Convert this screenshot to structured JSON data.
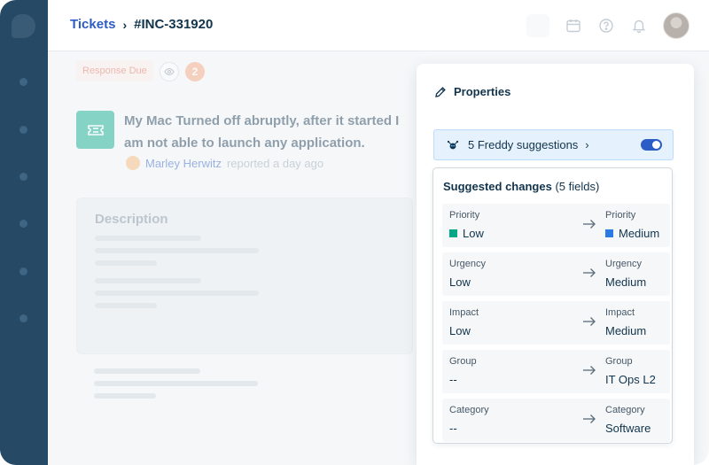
{
  "header": {
    "breadcrumb_root": "Tickets",
    "breadcrumb_sep": "›",
    "ticket_id": "#INC-331920",
    "icons": [
      "calendar-icon",
      "help-icon",
      "bell-icon",
      "avatar"
    ]
  },
  "ticket": {
    "status_tag": "Response Due",
    "watchers_count": "2",
    "subject": "My Mac Turned off abruptly, after it started I am not able to launch any application.",
    "reporter_name": "Marley Herwitz",
    "reported_text": "reported a day ago",
    "description_title": "Description"
  },
  "properties": {
    "title": "Properties",
    "freddy_label": "5 Freddy suggestions",
    "freddy_enabled": true,
    "suggested_title": "Suggested changes",
    "suggested_count": "(5 fields)",
    "changes": [
      {
        "field": "Priority",
        "from": "Low",
        "to": "Medium",
        "from_color": "#00a886",
        "to_color": "#2c7be5"
      },
      {
        "field": "Urgency",
        "from": "Low",
        "to": "Medium"
      },
      {
        "field": "Impact",
        "from": "Low",
        "to": "Medium"
      },
      {
        "field": "Group",
        "from": "--",
        "to": "IT Ops L2"
      },
      {
        "field": "Category",
        "from": "--",
        "to": "Software"
      }
    ]
  },
  "colors": {
    "rail": "#264966",
    "accent": "#2c5cc5",
    "ticket_icon": "#00a886",
    "freddy_bg": "#e5f2fd"
  }
}
